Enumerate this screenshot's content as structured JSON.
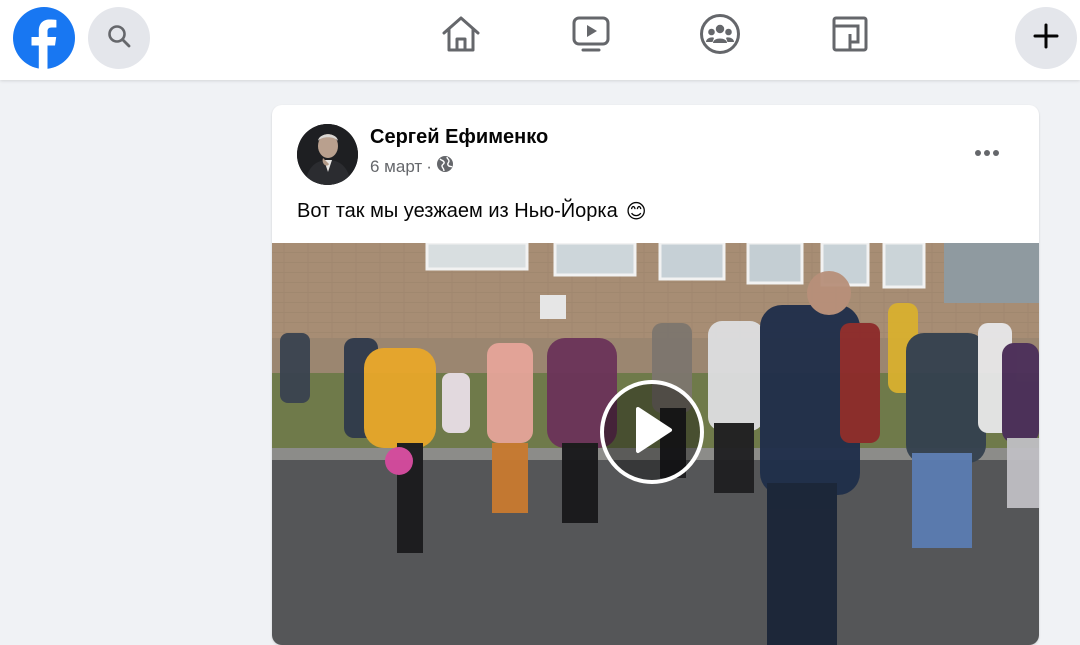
{
  "header": {
    "logo_icon": "facebook-logo-icon",
    "search_icon": "search-icon",
    "nav": [
      {
        "name": "home",
        "icon": "home-icon"
      },
      {
        "name": "watch",
        "icon": "video-play-icon"
      },
      {
        "name": "groups",
        "icon": "groups-icon"
      },
      {
        "name": "gaming",
        "icon": "gaming-icon"
      }
    ],
    "create_icon": "plus-icon"
  },
  "post": {
    "author": "Сергей Ефименко",
    "date": "6 март",
    "separator": "·",
    "audience_icon": "globe-icon",
    "text": "Вот так мы уезжаем из Нью-Йорка",
    "emoji": "😊",
    "more_icon": "more-dots-icon",
    "video": {
      "play_icon": "play-icon"
    }
  },
  "colors": {
    "brand": "#1877f2",
    "background": "#f0f2f5",
    "text": "#050505",
    "secondary_text": "#65676b",
    "icon_bg": "#e4e6eb"
  }
}
